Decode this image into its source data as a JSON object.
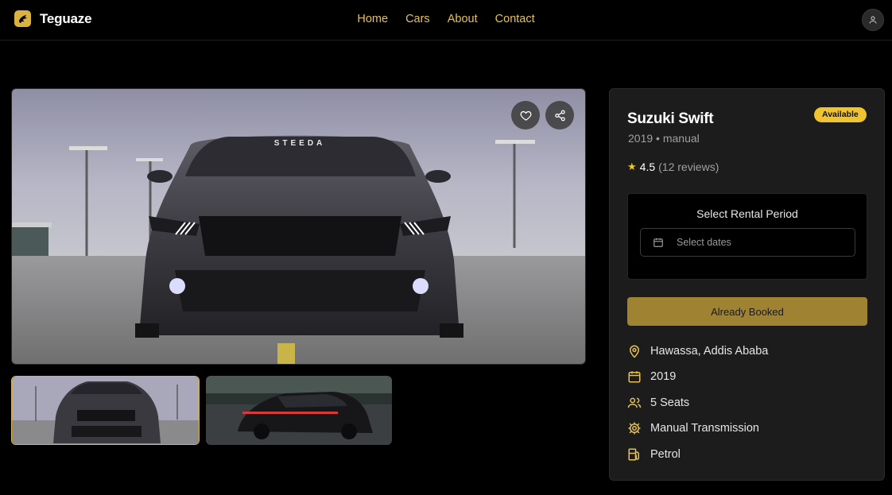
{
  "brand": {
    "name": "Teguaze"
  },
  "nav": {
    "links": [
      "Home",
      "Cars",
      "About",
      "Contact"
    ]
  },
  "car": {
    "title": "Suzuki Swift",
    "status": "Available",
    "year": "2019",
    "transmission": "manual",
    "rating": "4.5",
    "reviews": "(12 reviews)"
  },
  "rental": {
    "title": "Select Rental Period",
    "date_placeholder": "Select dates",
    "action_label": "Already Booked"
  },
  "specs": {
    "location": "Hawassa, Addis Ababa",
    "year": "2019",
    "seats": "5 Seats",
    "transmission": "Manual Transmission",
    "fuel": "Petrol"
  },
  "image_text": {
    "windshield_banner": "STEEDA"
  },
  "colors": {
    "accent": "#e6c15a",
    "badge": "#f0c430",
    "button": "#9f8232"
  },
  "icons": [
    "brand-logo-icon",
    "user-icon",
    "heart-icon",
    "share-icon",
    "calendar-icon",
    "map-pin-icon",
    "users-icon",
    "gear-icon",
    "fuel-icon"
  ]
}
